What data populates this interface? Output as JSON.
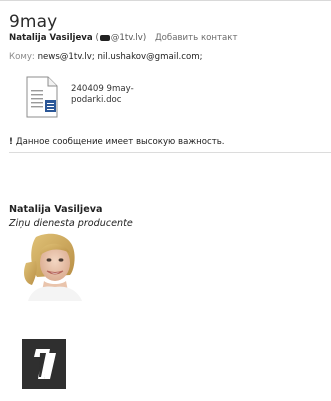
{
  "email": {
    "subject": "9may",
    "sender": {
      "name": "Natalija Vasiljeva",
      "email_open": "(",
      "email_domain": "@1tv.lv)",
      "add_contact": "Добавить контакт"
    },
    "to": {
      "label": "Кому:",
      "value": "news@1tv.lv; nil.ushakov@gmail.com;"
    },
    "attachment": {
      "name_line1": "240409 9may-",
      "name_line2": "podarki.doc",
      "icon": "word-document-icon"
    },
    "importance": {
      "icon": "exclamation-icon",
      "text": "Данное сообщение имеет высокую важность."
    }
  },
  "signature": {
    "name": "Natalija Vasiljeva",
    "title": "Ziņu dienesta producente",
    "photo": "portrait-photo",
    "logo": "channel-one-logo"
  },
  "colors": {
    "logo_bg": "#2f2f2f",
    "doc_blue": "#2b5797",
    "text_muted": "#8a8a8a"
  }
}
